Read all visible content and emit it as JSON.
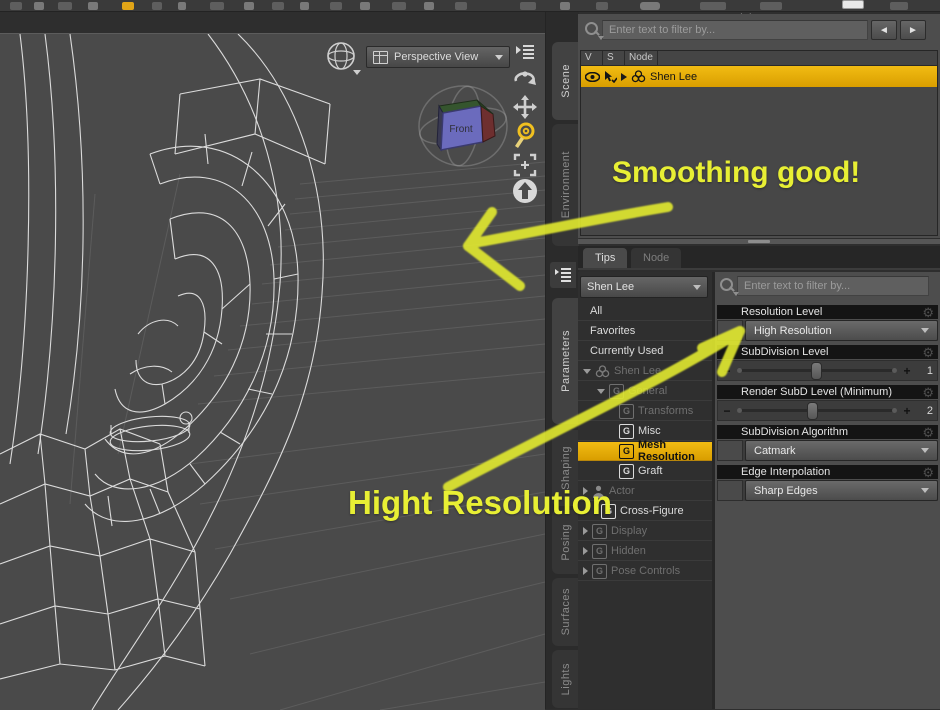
{
  "ui": {
    "gear_glyph": "⚙",
    "slider_minus": "−",
    "slider_plus": "+",
    "nav_back": "◄",
    "nav_forward": "►",
    "group_icon_letter": "G"
  },
  "viewport": {
    "view_selector": {
      "value": "Perspective View"
    },
    "view_cube": {
      "front_label": "Front"
    },
    "tools": [
      "pane-options",
      "orbit",
      "pan",
      "zoom",
      "frame",
      "aim"
    ]
  },
  "side_tabs": {
    "top": [
      "Scene",
      "Environment"
    ],
    "bottom": [
      "Parameters",
      "Shaping",
      "Posing",
      "Surfaces",
      "Lights"
    ]
  },
  "scene_panel": {
    "filter_placeholder": "Enter text to filter by...",
    "columns": {
      "visibility": "V",
      "selection": "S",
      "node": "Node"
    },
    "rows": [
      {
        "name": "Shen Lee",
        "selected": true
      }
    ]
  },
  "tip_tabs": {
    "tips": "Tips",
    "node": "Node"
  },
  "parameters_panel": {
    "node_selector": "Shen Lee",
    "filter_placeholder": "Enter text to filter by...",
    "tree": [
      {
        "label": "All",
        "state": "enabled"
      },
      {
        "label": "Favorites",
        "state": "enabled"
      },
      {
        "label": "Currently Used",
        "state": "enabled"
      },
      {
        "label": "Shen Lee",
        "state": "disabled"
      },
      {
        "label": "General",
        "state": "disabled"
      },
      {
        "label": "Transforms",
        "state": "disabled"
      },
      {
        "label": "Misc",
        "state": "enabled"
      },
      {
        "label": "Mesh Resolution",
        "state": "selected"
      },
      {
        "label": "Graft",
        "state": "enabled"
      },
      {
        "label": "Actor",
        "state": "disabled"
      },
      {
        "label": "Cross-Figure",
        "state": "enabled"
      },
      {
        "label": "Display",
        "state": "disabled"
      },
      {
        "label": "Hidden",
        "state": "disabled"
      },
      {
        "label": "Pose Controls",
        "state": "disabled"
      }
    ],
    "properties": [
      {
        "label": "Resolution Level",
        "type": "dropdown",
        "value": "High Resolution"
      },
      {
        "label": "SubDivision Level",
        "type": "slider",
        "value": "1"
      },
      {
        "label": "Render SubD Level (Minimum)",
        "type": "slider",
        "value": "2"
      },
      {
        "label": "SubDivision Algorithm",
        "type": "dropdown",
        "value": "Catmark"
      },
      {
        "label": "Edge Interpolation",
        "type": "dropdown",
        "value": "Sharp Edges"
      }
    ]
  },
  "annotations": {
    "note1": "Smoothing good!",
    "note2": "Hight Resolution",
    "color": "#e8ef34"
  },
  "colors": {
    "selection_highlight": "#edb300",
    "viewport_bg": "#4a4a4a",
    "panel_bg": "#2e2e2e",
    "zoom_tool_active": "#f0c020"
  }
}
